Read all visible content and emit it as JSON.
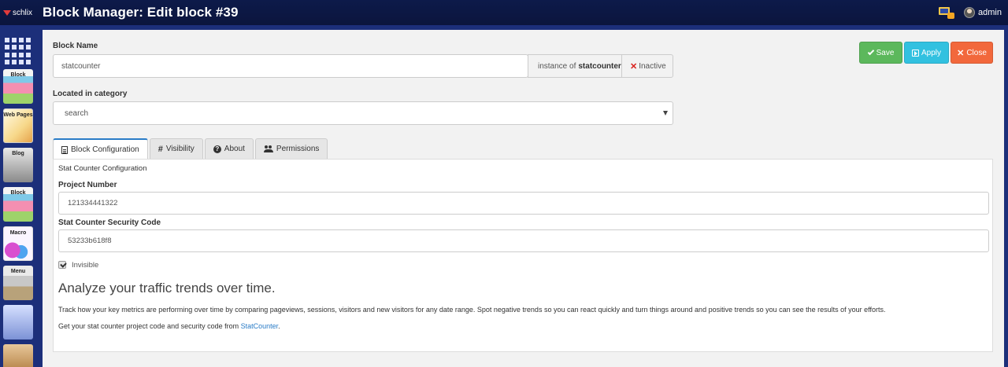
{
  "header": {
    "brand": "schlix",
    "title": "Block Manager: Edit block #39",
    "notification_badge": "10",
    "user": "admin"
  },
  "sidebar": {
    "items": [
      {
        "name": "apps-grid",
        "label": ""
      },
      {
        "name": "block",
        "label": "Block"
      },
      {
        "name": "web-pages",
        "label": "Web Pages"
      },
      {
        "name": "blog",
        "label": "Blog"
      },
      {
        "name": "block-2",
        "label": "Block"
      },
      {
        "name": "macro",
        "label": "Macro"
      },
      {
        "name": "menu",
        "label": "Menu"
      },
      {
        "name": "users",
        "label": ""
      },
      {
        "name": "tools",
        "label": ""
      }
    ]
  },
  "form": {
    "block_name_label": "Block Name",
    "block_name_value": "statcounter",
    "instance_prefix": "instance of",
    "instance_name": "statcounter",
    "status_text": "Inactive",
    "category_label": "Located in category",
    "category_value": "search"
  },
  "buttons": {
    "save": "Save",
    "apply": "Apply",
    "close": "Close"
  },
  "tabs": [
    {
      "label": "Block Configuration",
      "active": true
    },
    {
      "label": "Visibility",
      "active": false
    },
    {
      "label": "About",
      "active": false
    },
    {
      "label": "Permissions",
      "active": false
    }
  ],
  "config": {
    "section_title": "Stat Counter Configuration",
    "project_number_label": "Project Number",
    "project_number_value": "121334441322",
    "security_code_label": "Stat Counter Security Code",
    "security_code_value": "53233b618f8",
    "invisible_label": "Invisible",
    "invisible_checked": true,
    "heading": "Analyze your traffic trends over time.",
    "description": "Track how your key metrics are performing over time by comparing pageviews, sessions, visitors and new visitors for any date range. Spot negative trends so you can react quickly and turn things around and positive trends so you can see the results of your efforts.",
    "link_prefix": "Get your stat counter project code and security code from",
    "link_text": "StatCounter",
    "link_suffix": "."
  },
  "colors": {
    "header_bg": "#0d1a4a",
    "page_bg": "#1c2f7a",
    "save": "#5cb85c",
    "apply": "#32c1e0",
    "close": "#f2683c",
    "link": "#2a7cc7",
    "inactive": "#d9201b"
  }
}
